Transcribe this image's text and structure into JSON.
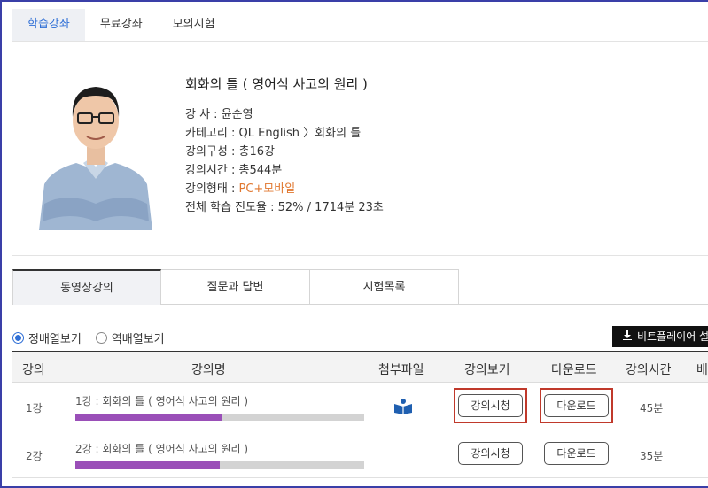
{
  "top_tabs": [
    "학습강좌",
    "무료강좌",
    "모의시험"
  ],
  "course": {
    "title": "회화의 틀 ( 영어식 사고의 원리 )",
    "rows": [
      {
        "label": "강 사 : ",
        "value": "윤순영"
      },
      {
        "label": "카테고리 : ",
        "value": "QL English 〉회화의 틀"
      },
      {
        "label": "강의구성 : ",
        "value": "총16강"
      },
      {
        "label": "강의시간 : ",
        "value": "총544분"
      },
      {
        "label": "강의형태 : ",
        "value": "PC+모바일"
      },
      {
        "label": "전체 학습 진도율 : ",
        "value": "52% / 1714분 23초"
      }
    ]
  },
  "sub_tabs": [
    "동영상강의",
    "질문과 답변",
    "시험목록"
  ],
  "sort": {
    "option1": "정배열보기",
    "option2": "역배열보기",
    "selected": "정배열보기"
  },
  "player_button": "비트플레이어 설",
  "table": {
    "headers": [
      "강의",
      "강의명",
      "첨부파일",
      "강의보기",
      "다운로드",
      "강의시간",
      "배"
    ],
    "rows": [
      {
        "no": "1강",
        "title": "1강 : 회화의 틀 ( 영어식 사고의 원리 )",
        "progress": 0.51,
        "has_file": true,
        "view": "강의시청",
        "download": "다운로드",
        "time": "45분"
      },
      {
        "no": "2강",
        "title": "2강 : 회화의 틀 ( 영어식 사고의 원리 )",
        "progress": 0.5,
        "has_file": false,
        "view": "강의시청",
        "download": "다운로드",
        "time": "35분"
      }
    ]
  },
  "colors": {
    "accent": "#e0772f",
    "progress": "#9a4fb8",
    "tab_active": "#2f6fd6",
    "highlight": "#c0392b"
  },
  "icons": {
    "attachment": "book-download-icon",
    "download": "download-icon"
  }
}
